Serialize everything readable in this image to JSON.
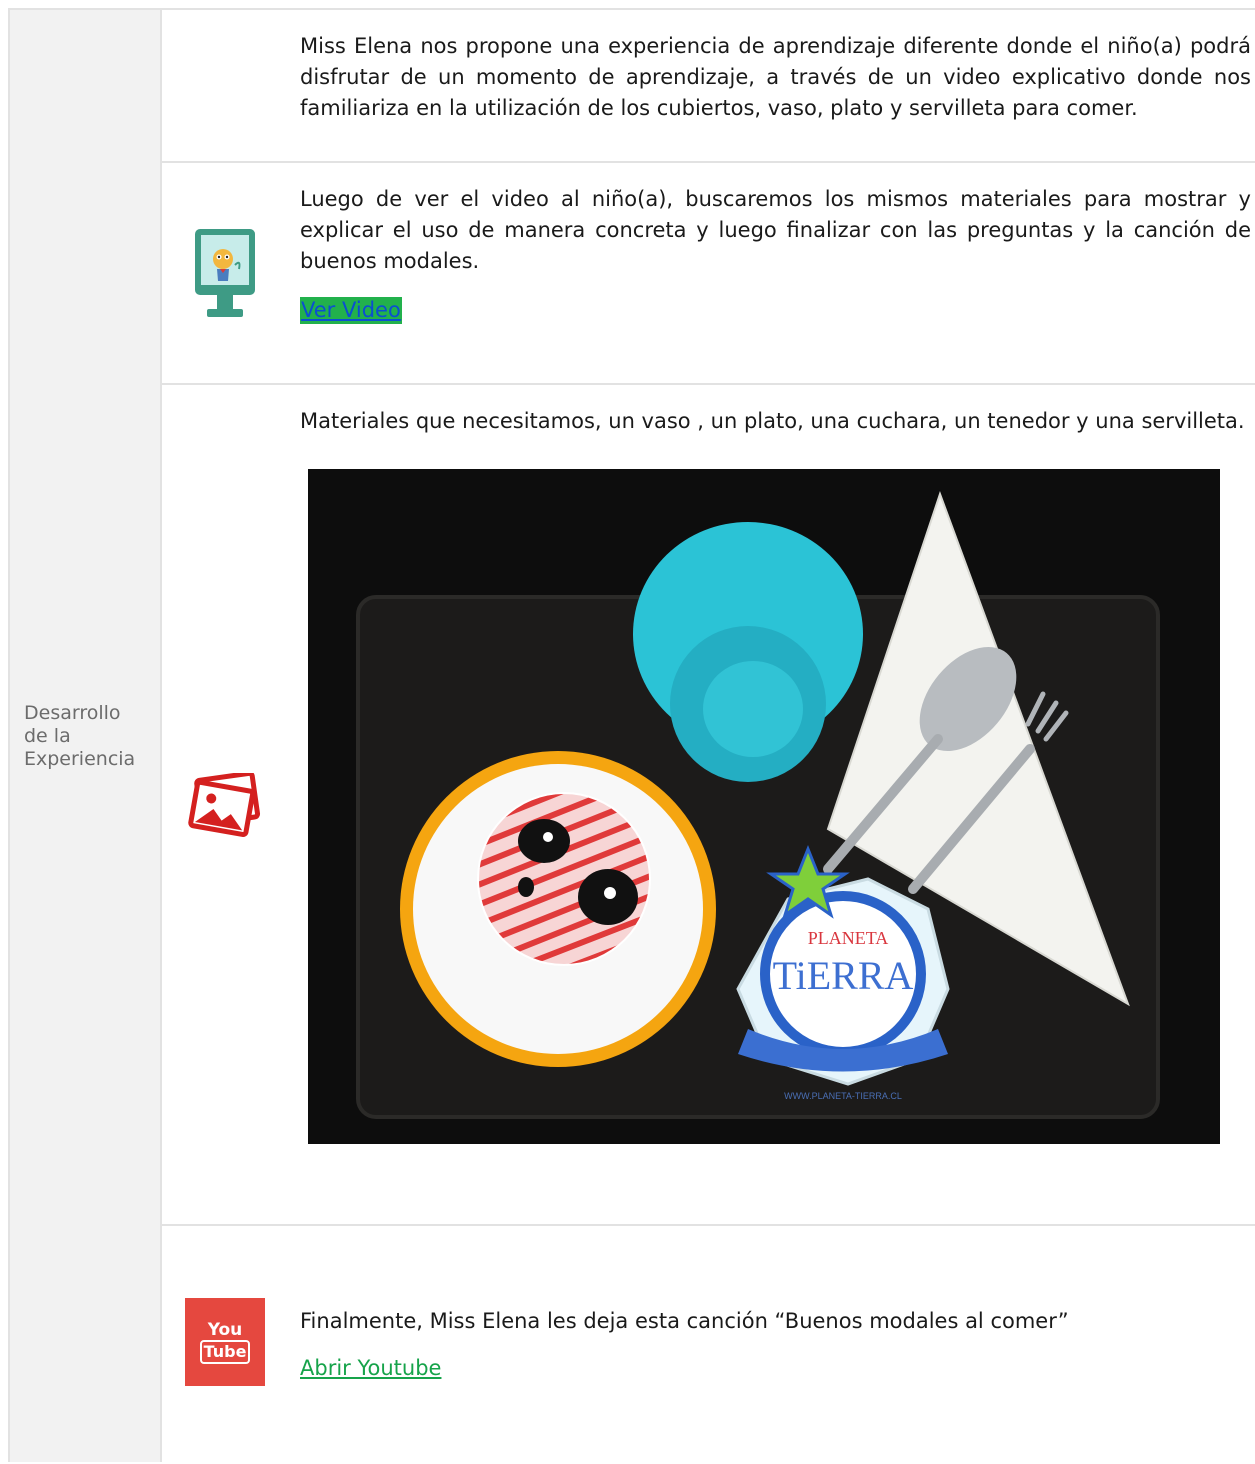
{
  "section_label": "Desarrollo de la Experiencia",
  "rows": [
    {
      "text": "Miss Elena nos propone una experiencia de aprendizaje diferente donde el niño(a) podrá disfrutar de un momento de aprendizaje, a través de un video explicativo donde nos familiariza en la utilización de los cubiertos, vaso, plato y servilleta para comer."
    },
    {
      "text": "Luego de ver el video al niño(a), buscaremos los mismos materiales para mostrar y explicar el uso de manera concreta y luego finalizar con las preguntas y la canción de buenos modales.",
      "link": "Ver Video",
      "icon": "video-monitor-icon"
    },
    {
      "text": "Materiales que necesitamos, un vaso , un plato, una cuchara, un tenedor y una servilleta.",
      "icon": "image-gallery-icon",
      "photo_text": {
        "brand_top": "PLANETA",
        "brand_main": "TiERRA",
        "url": "WWW.PLANETA-TIERRA.CL"
      }
    },
    {
      "text": "Finalmente, Miss Elena les deja esta canción “Buenos modales al comer”",
      "link": "Abrir Youtube",
      "icon": "youtube-icon",
      "youtube": {
        "line1": "You",
        "line2": "Tube"
      }
    }
  ],
  "colors": {
    "link_highlight": "#22b14c",
    "youtube_red": "#e5483f",
    "gallery_red": "#d4201f"
  }
}
